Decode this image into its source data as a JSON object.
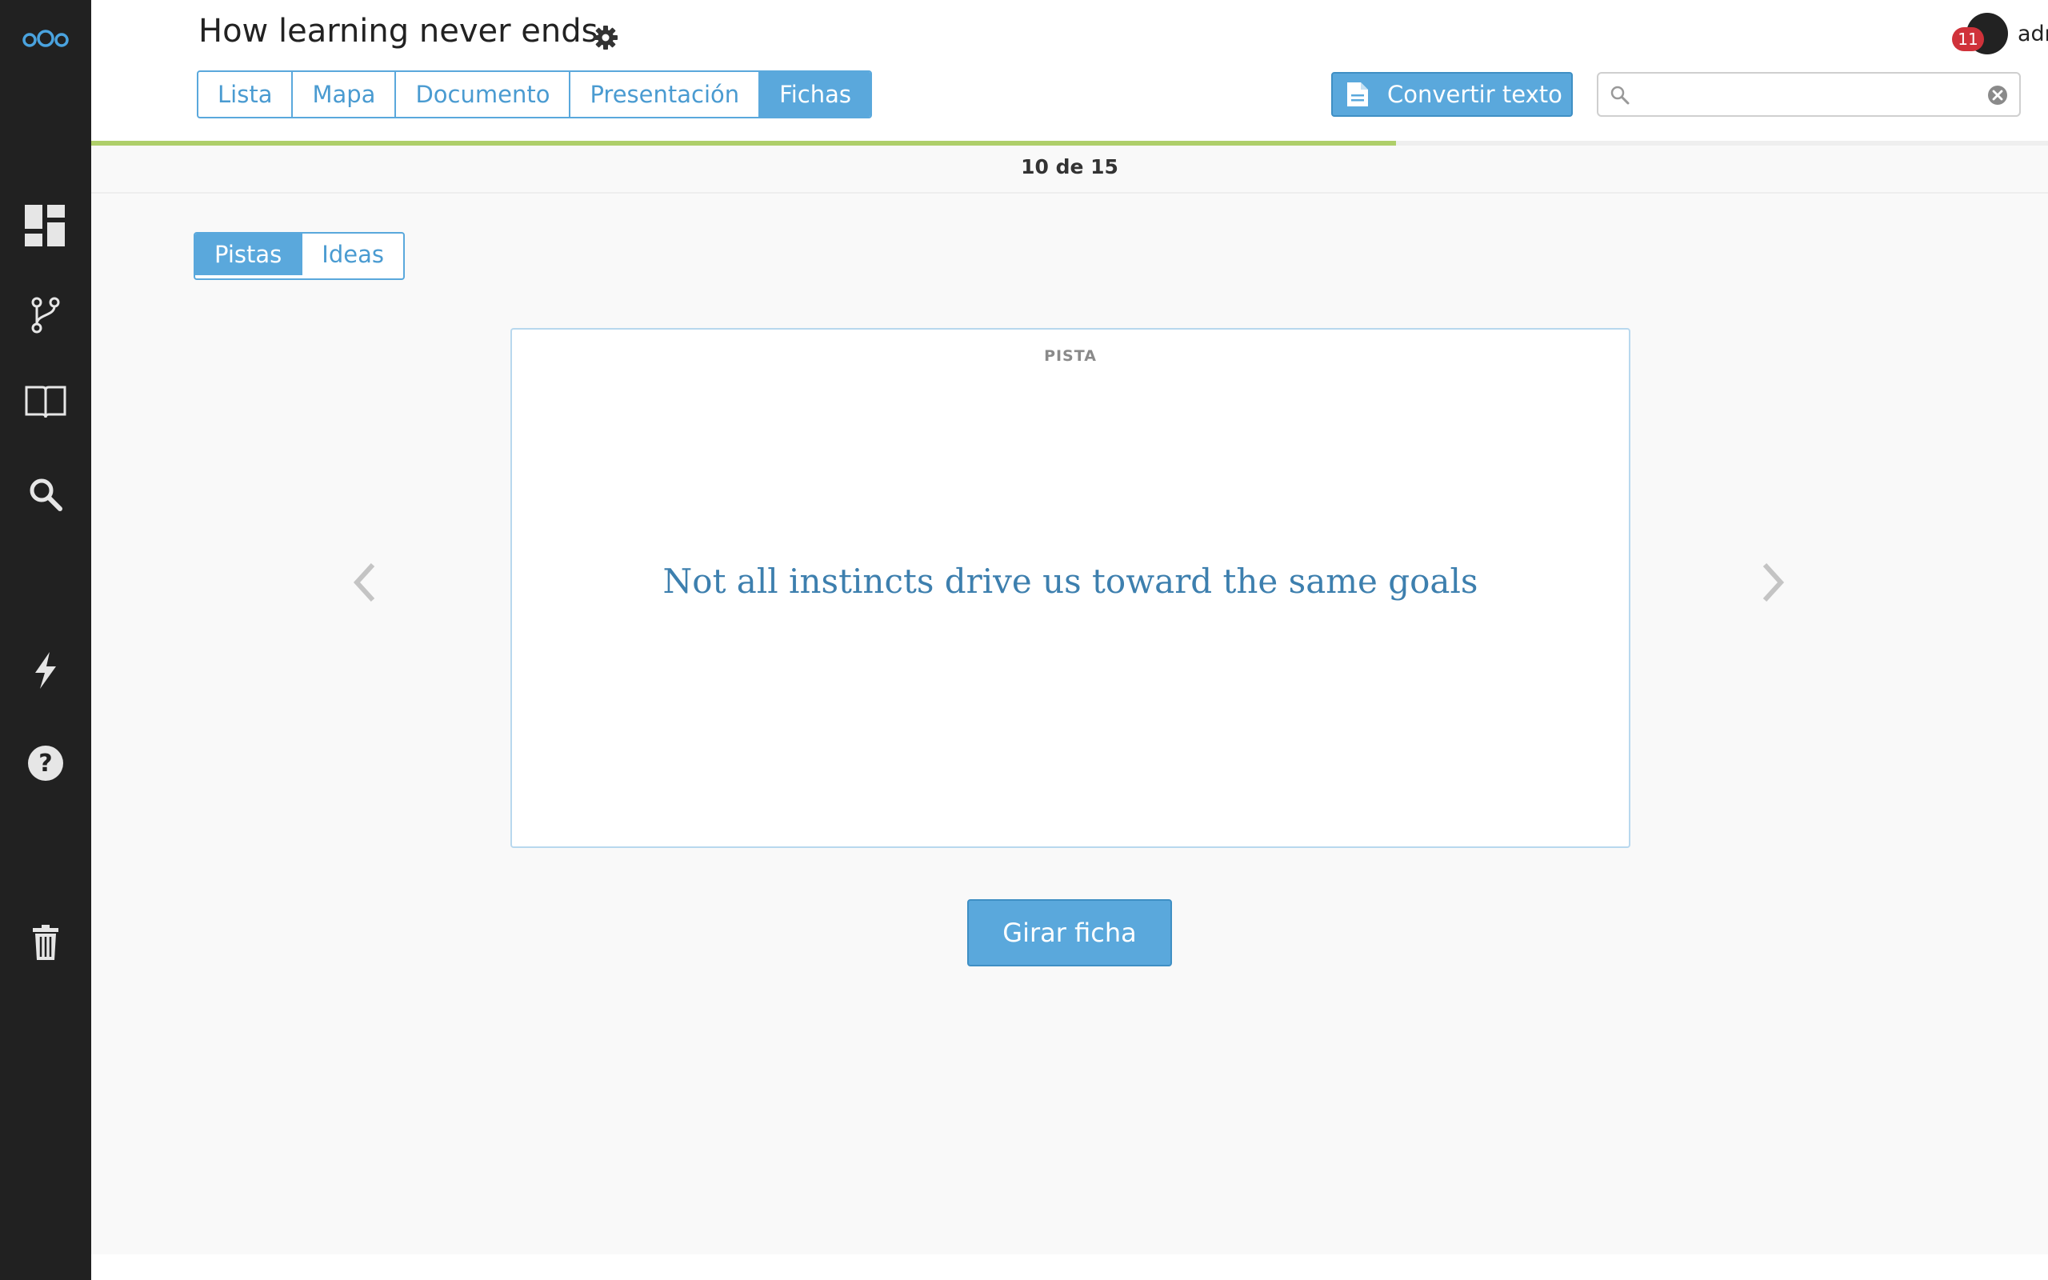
{
  "app": {
    "logo_icon": "nextcloud-logo-icon"
  },
  "sidebar": {
    "items": [
      {
        "icon": "dashboard-icon"
      },
      {
        "icon": "branch-icon"
      },
      {
        "icon": "book-icon"
      },
      {
        "icon": "search-icon"
      },
      {
        "icon": "lightning-icon"
      },
      {
        "icon": "help-icon"
      },
      {
        "icon": "trash-icon"
      }
    ]
  },
  "header": {
    "title": "How learning never ends",
    "view_tabs": [
      {
        "label": "Lista",
        "active": false
      },
      {
        "label": "Mapa",
        "active": false
      },
      {
        "label": "Documento",
        "active": false
      },
      {
        "label": "Presentación",
        "active": false
      },
      {
        "label": "Fichas",
        "active": true
      }
    ],
    "convert_button": "Convertir texto",
    "search": {
      "value": "",
      "placeholder": ""
    },
    "user": {
      "name": "adriano",
      "notifications": "11"
    }
  },
  "progress": {
    "current": 10,
    "total": 15,
    "fraction": 0.6667,
    "text": "10 de 15"
  },
  "side_toggle": [
    {
      "label": "Pistas",
      "active": true
    },
    {
      "label": "Ideas",
      "active": false
    }
  ],
  "card": {
    "label": "PISTA",
    "text": "Not all instincts drive us toward the same goals"
  },
  "flip_button": "Girar ficha",
  "colors": {
    "sidebar_bg": "#212121",
    "accent": "#5aa8dc",
    "card_text": "#3d7fae",
    "progress": "#afcf6a",
    "badge": "#d0323a"
  }
}
